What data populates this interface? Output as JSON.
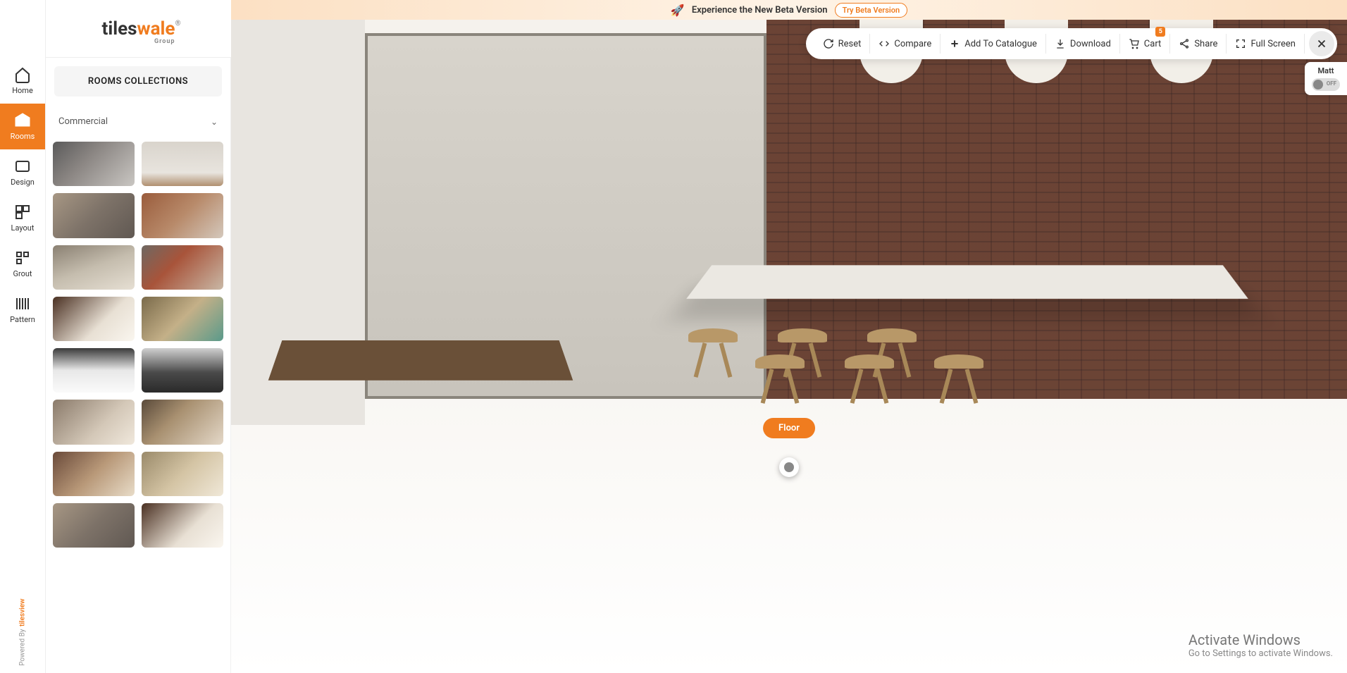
{
  "banner": {
    "text": "Experience the New Beta Version",
    "button": "Try Beta Version"
  },
  "logo": {
    "part1": "tiles",
    "part2": "wale",
    "group": "Group",
    "reg": "®"
  },
  "nav": {
    "home": "Home",
    "rooms": "Rooms",
    "design": "Design",
    "layout": "Layout",
    "grout": "Grout",
    "pattern": "Pattern"
  },
  "poweredBy": {
    "prefix": "Powered By",
    "brand": "tilesview"
  },
  "sidebar": {
    "header": "ROOMS COLLECTIONS",
    "dropdown": "Commercial"
  },
  "toolbar": {
    "reset": "Reset",
    "compare": "Compare",
    "addCatalogue": "Add To Catalogue",
    "download": "Download",
    "cart": "Cart",
    "cartBadge": "5",
    "share": "Share",
    "fullscreen": "Full Screen"
  },
  "hotspot": {
    "floor": "Floor"
  },
  "matt": {
    "label": "Matt",
    "off": "OFF"
  },
  "watermark": {
    "heading": "Activate Windows",
    "sub": "Go to Settings to activate Windows."
  }
}
